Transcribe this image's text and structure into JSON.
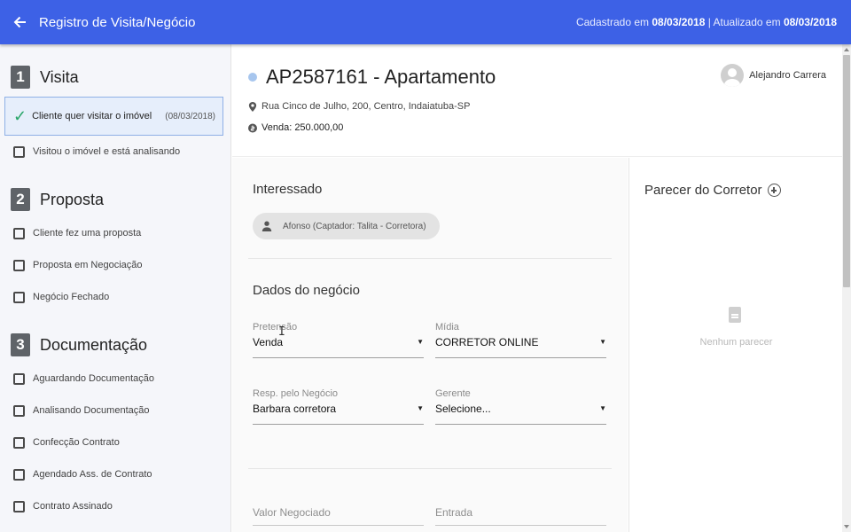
{
  "header": {
    "title": "Registro de Visita/Negócio",
    "registered_label": "Cadastrado em",
    "registered_date": "08/03/2018",
    "updated_label": "| Atualizado em",
    "updated_date": "08/03/2018"
  },
  "sidebar": {
    "sections": [
      {
        "number": "1",
        "title": "Visita",
        "steps": [
          {
            "label": "Cliente quer visitar o imóvel",
            "date": "(08/03/2018)",
            "checked": true
          },
          {
            "label": "Visitou o imóvel e está analisando"
          }
        ]
      },
      {
        "number": "2",
        "title": "Proposta",
        "steps": [
          {
            "label": "Cliente fez uma proposta"
          },
          {
            "label": "Proposta em Negociação"
          },
          {
            "label": "Negócio Fechado"
          }
        ]
      },
      {
        "number": "3",
        "title": "Documentação",
        "steps": [
          {
            "label": "Aguardando Documentação"
          },
          {
            "label": "Analisando Documentação"
          },
          {
            "label": "Confecção Contrato"
          },
          {
            "label": "Agendado Ass. de Contrato"
          },
          {
            "label": "Contrato Assinado"
          }
        ]
      }
    ]
  },
  "property": {
    "title": "AP2587161 - Apartamento",
    "address": "Rua Cinco de Julho, 200, Centro, Indaiatuba-SP",
    "price": "Venda: 250.000,00"
  },
  "user": {
    "name": "Alejandro Carrera"
  },
  "interessado": {
    "heading": "Interessado",
    "chip": "Afonso (Captador: Talita - Corretora)"
  },
  "negocio": {
    "heading": "Dados do negócio",
    "fields": {
      "pretensao": {
        "label": "Pretensão",
        "value": "Venda"
      },
      "midia": {
        "label": "Mídia",
        "value": "CORRETOR ONLINE"
      },
      "resp": {
        "label": "Resp. pelo Negócio",
        "value": "Barbara corretora"
      },
      "gerente": {
        "label": "Gerente",
        "value": "Selecione..."
      },
      "valor": {
        "label": "Valor Negociado"
      },
      "entrada": {
        "label": "Entrada"
      }
    }
  },
  "parecer": {
    "heading": "Parecer do Corretor",
    "empty_text": "Nenhum parecer"
  },
  "colors": {
    "topbar": "#3d61e6",
    "active_step_bg": "#e6eefb",
    "check": "#2aa66a"
  }
}
